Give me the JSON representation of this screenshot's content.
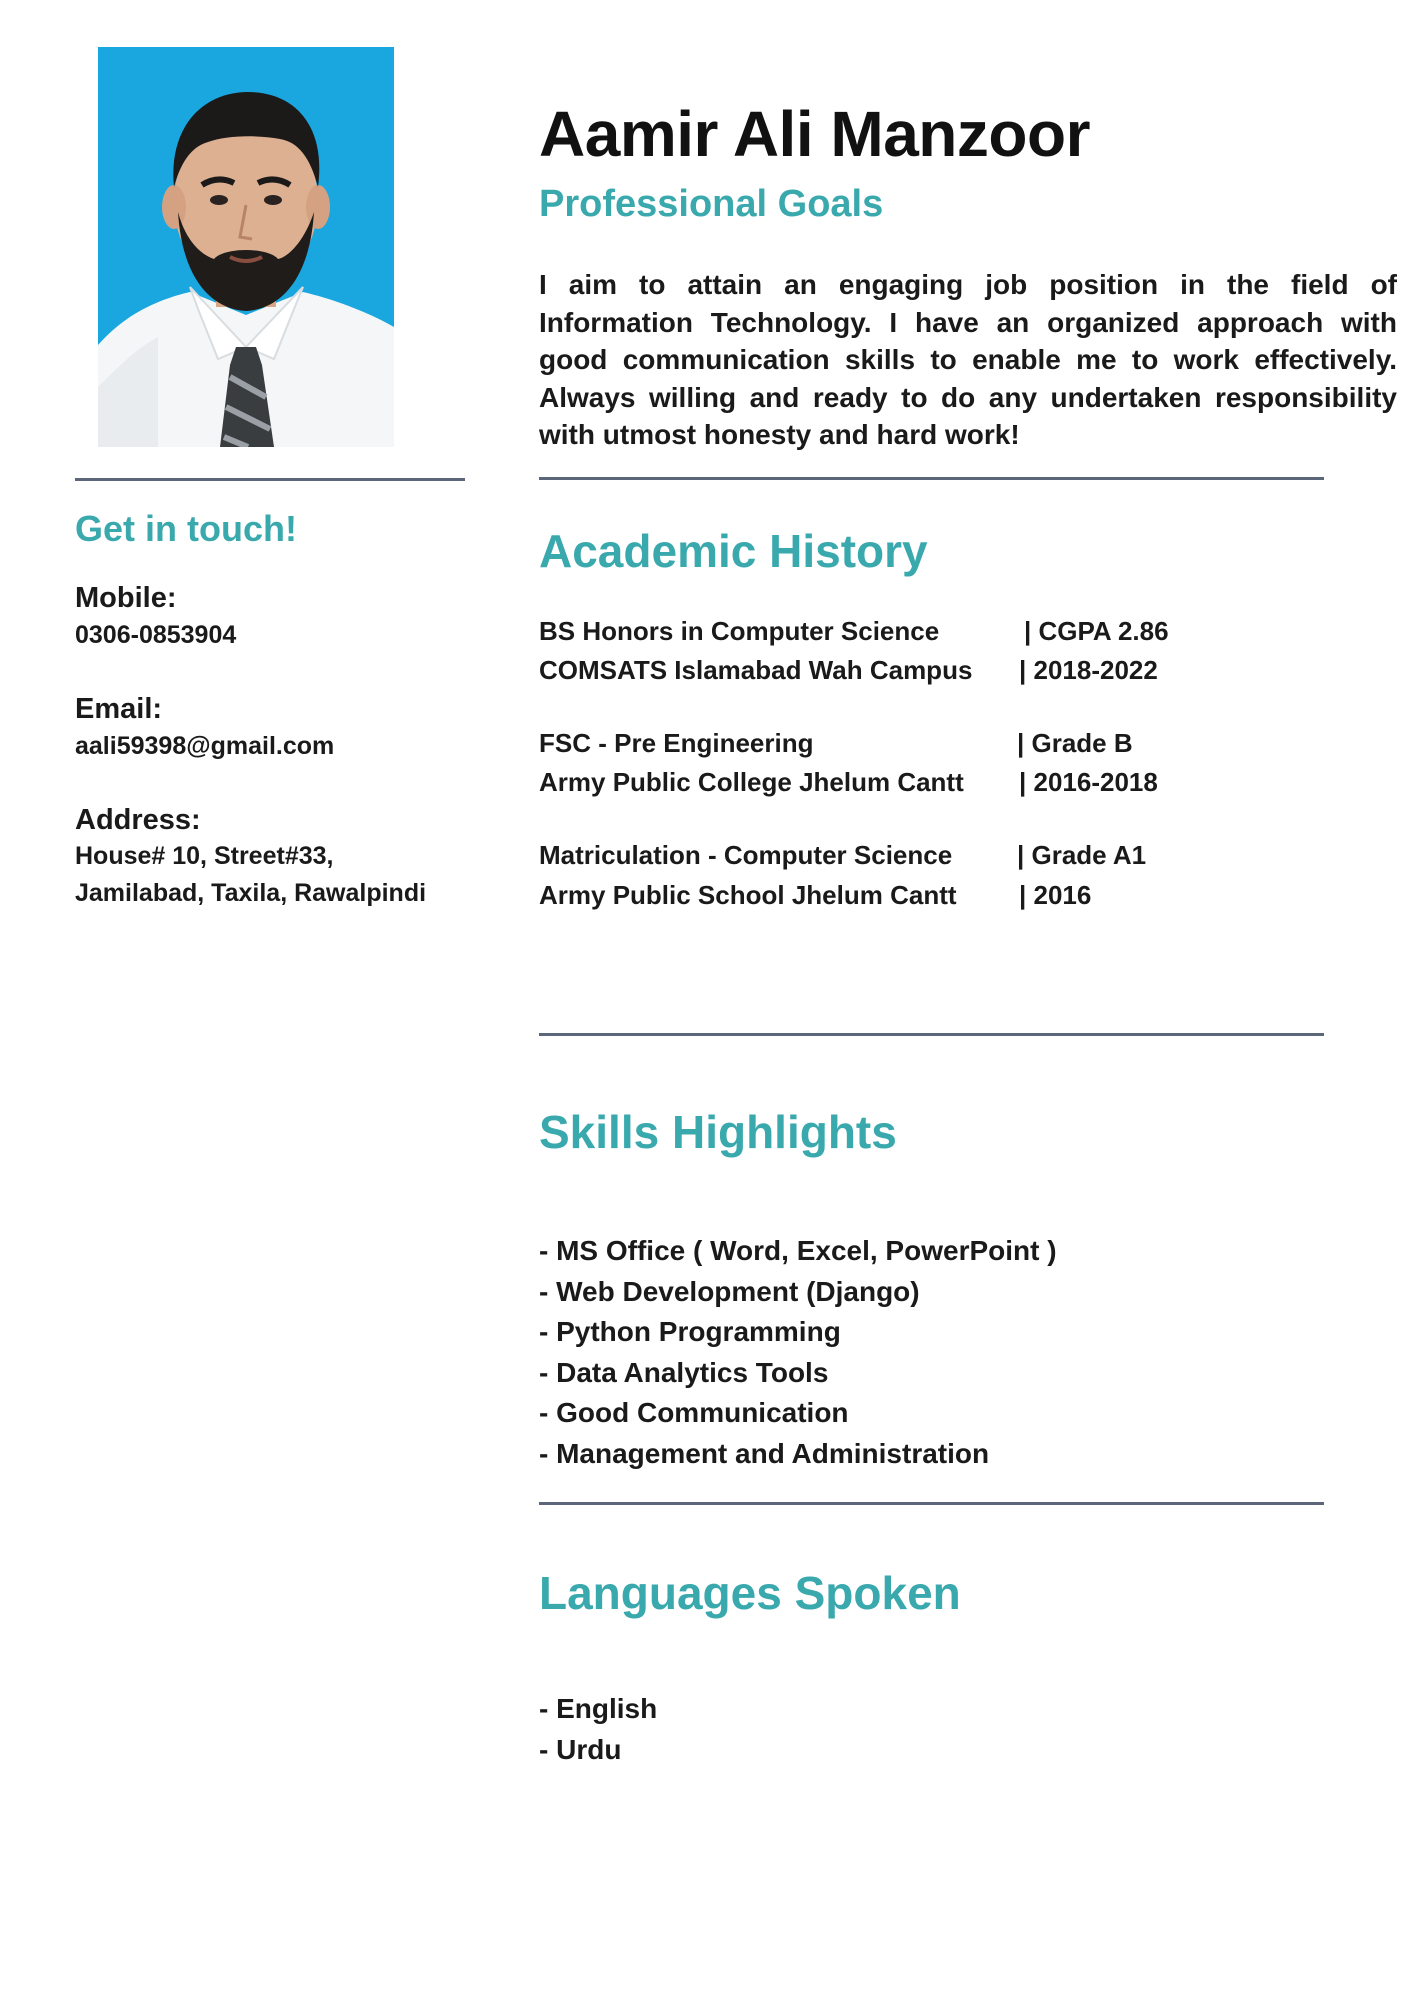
{
  "name": "Aamir Ali Manzoor",
  "goals": {
    "heading": "Professional Goals",
    "text": "I aim to attain an engaging job position in the field of Information Technology. I have an organized approach with good communication skills to enable me to work effectively. Always willing and ready to do any undertaken responsibility with utmost honesty and hard work!"
  },
  "contact": {
    "heading": "Get in touch!",
    "mobile_label": "Mobile:",
    "mobile": "0306-0853904",
    "email_label": "Email:",
    "email": "aali59398@gmail.com",
    "address_label": "Address:",
    "address_line1": "House# 10, Street#33,",
    "address_line2": "Jamilabad, Taxila, Rawalpindi"
  },
  "academic": {
    "heading": "Academic History",
    "entries": [
      {
        "degree": "BS Honors in Computer Science",
        "grade": "| CGPA 2.86",
        "institution": "COMSATS Islamabad Wah Campus",
        "years": "| 2018-2022"
      },
      {
        "degree": "FSC - Pre Engineering",
        "grade": "| Grade B",
        "institution": "Army Public College Jhelum Cantt",
        "years": "| 2016-2018"
      },
      {
        "degree": "Matriculation - Computer Science",
        "grade": "| Grade A1",
        "institution": "Army Public School Jhelum Cantt",
        "years": "| 2016"
      }
    ]
  },
  "skills": {
    "heading": "Skills Highlights",
    "items": [
      "- MS Office ( Word, Excel, PowerPoint )",
      "- Web Development (Django)",
      "- Python Programming",
      "- Data Analytics Tools",
      "- Good Communication",
      "- Management and Administration"
    ]
  },
  "languages": {
    "heading": "Languages Spoken",
    "items": [
      "- English",
      "- Urdu"
    ]
  },
  "colors": {
    "accent": "#3aa9ad",
    "rule": "#5b6678",
    "photo_background": "#1aa6df",
    "text": "#1a1a1a"
  }
}
